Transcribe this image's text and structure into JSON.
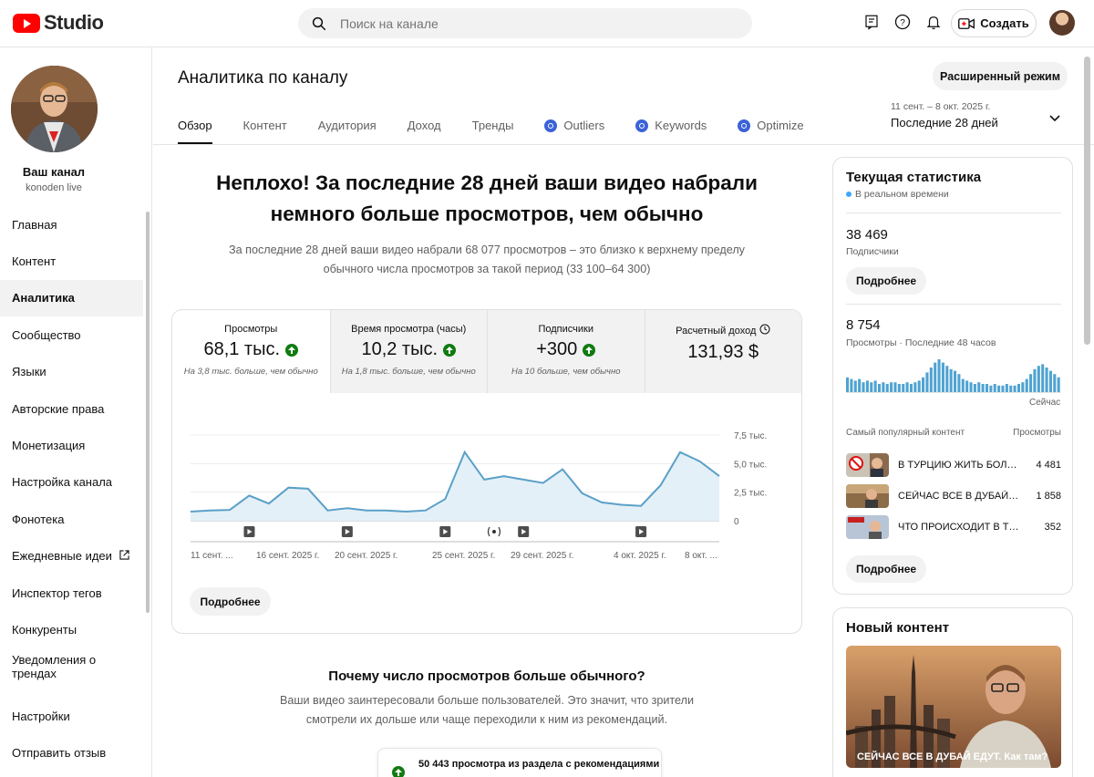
{
  "header": {
    "logo_text": "Studio",
    "search_placeholder": "Поиск на канале",
    "create_label": "Создать"
  },
  "sidebar": {
    "channel_name": "Ваш канал",
    "channel_handle": "konoden live",
    "items": [
      {
        "label": "Главная"
      },
      {
        "label": "Контент"
      },
      {
        "label": "Аналитика",
        "active": true
      },
      {
        "label": "Сообщество"
      },
      {
        "label": "Языки"
      },
      {
        "label": "Авторские права"
      },
      {
        "label": "Монетизация"
      },
      {
        "label": "Настройка канала"
      },
      {
        "label": "Фонотека"
      },
      {
        "label": "Ежедневные идеи",
        "external": true
      },
      {
        "label": "Инспектор тегов"
      },
      {
        "label": "Конкуренты"
      },
      {
        "label": "Уведомления о трендах"
      }
    ],
    "bottom_items": [
      {
        "label": "Настройки"
      },
      {
        "label": "Отправить отзыв"
      }
    ]
  },
  "main": {
    "title": "Аналитика по каналу",
    "advanced_mode": "Расширенный режим",
    "tabs": [
      {
        "label": "Обзор",
        "active": true
      },
      {
        "label": "Контент"
      },
      {
        "label": "Аудитория"
      },
      {
        "label": "Доход"
      },
      {
        "label": "Тренды"
      },
      {
        "label": "Outliers",
        "icon": "vidiq-icon"
      },
      {
        "label": "Keywords",
        "icon": "vidiq-icon"
      },
      {
        "label": "Optimize",
        "icon": "vidiq-icon"
      }
    ],
    "date_range": {
      "dates": "11 сент. – 8 окт. 2025 г.",
      "period": "Последние 28 дней"
    },
    "headline_line1": "Неплохо! За последние 28 дней ваши видео набрали",
    "headline_line2": "немного больше просмотров, чем обычно",
    "subline_line1": "За последние 28 дней ваши видео набрали 68 077 просмотров – это близко к верхнему пределу",
    "subline_line2": "обычного числа просмотров за такой период (33 100–64 300)",
    "metrics": [
      {
        "label": "Просмотры",
        "value": "68,1 тыс.",
        "up": true,
        "note": "На 3,8 тыс. больше, чем обычно"
      },
      {
        "label": "Время просмотра (часы)",
        "value": "10,2 тыс.",
        "up": true,
        "note": "На 1,8 тыс. больше, чем обычно"
      },
      {
        "label": "Подписчики",
        "value": "+300",
        "up": true,
        "note": "На 10 больше, чем обычно"
      },
      {
        "label": "Расчетный доход",
        "value": "131,93 $",
        "up": false,
        "note": "",
        "clock": true
      }
    ],
    "more_button": "Подробнее",
    "why_title": "Почему число просмотров больше обычного?",
    "why_line1": "Ваши видео заинтересовали больше пользователей. Это значит, что зрители",
    "why_line2": "смотрели их дольше или чаще переходили к ним из рекомендаций.",
    "reco_text": "50 443 просмотра из раздела с рекомендациями"
  },
  "chart_data": {
    "type": "area",
    "x_tick_labels": [
      "11 сент. ...",
      "16 сент. 2025 г.",
      "20 сент. 2025 г.",
      "25 сент. 2025 г.",
      "29 сент. 2025 г.",
      "4 окт. 2025 г.",
      "8 окт. ..."
    ],
    "y_tick_labels": [
      "7,5 тыс.",
      "5,0 тыс.",
      "2,5 тыс.",
      "0"
    ],
    "ylim": [
      0,
      7500
    ],
    "values": [
      800,
      900,
      950,
      2200,
      1500,
      2900,
      2800,
      900,
      1100,
      900,
      900,
      800,
      900,
      1900,
      6000,
      3600,
      3900,
      3600,
      3300,
      4500,
      2400,
      1600,
      1400,
      1300,
      3100,
      6000,
      5200,
      3900
    ],
    "event_markers": [
      "video",
      "video",
      "video",
      "live",
      "video",
      "video"
    ],
    "event_positions": [
      3,
      8,
      13,
      15.5,
      17,
      23
    ],
    "line_color": "#5aa0c8",
    "fill_color": "#e4f0f7"
  },
  "realtime": {
    "title": "Текущая статистика",
    "live": "В реальном времени",
    "subscribers": "38 469",
    "subscribers_label": "Подписчики",
    "more_button": "Подробнее",
    "views": "8 754",
    "views_label": "Просмотры · Последние 48 часов",
    "now_label": "Сейчас",
    "bars": [
      9,
      8,
      7,
      8,
      6,
      7,
      6,
      7,
      5,
      6,
      5,
      6,
      6,
      5,
      5,
      6,
      5,
      6,
      7,
      9,
      12,
      15,
      18,
      20,
      18,
      16,
      14,
      13,
      11,
      8,
      7,
      6,
      5,
      6,
      5,
      5,
      4,
      5,
      4,
      4,
      5,
      4,
      4,
      5,
      6,
      8,
      11,
      14,
      16,
      17,
      15,
      13,
      11,
      9
    ],
    "bar_color": "#4fa3d1",
    "top_content_label": "Самый популярный контент",
    "top_views_label": "Просмотры",
    "top_items": [
      {
        "title": "В ТУРЦИЮ ЖИТЬ БОЛЬШЕ НЕ ПОЕДУ!",
        "views": "4 481"
      },
      {
        "title": "СЕЙЧАС ВСЕ В ДУБАЙ ЕДУТ. Как там?",
        "views": "1 858"
      },
      {
        "title": "ЧТО ПРОИСХОДИТ В ТУРЦИИ?",
        "views": "352"
      }
    ],
    "more_button2": "Подробнее"
  },
  "new_content": {
    "title": "Новый контент",
    "video_title": "СЕЙЧАС ВСЕ В ДУБАЙ ЕДУТ. Как там?"
  }
}
